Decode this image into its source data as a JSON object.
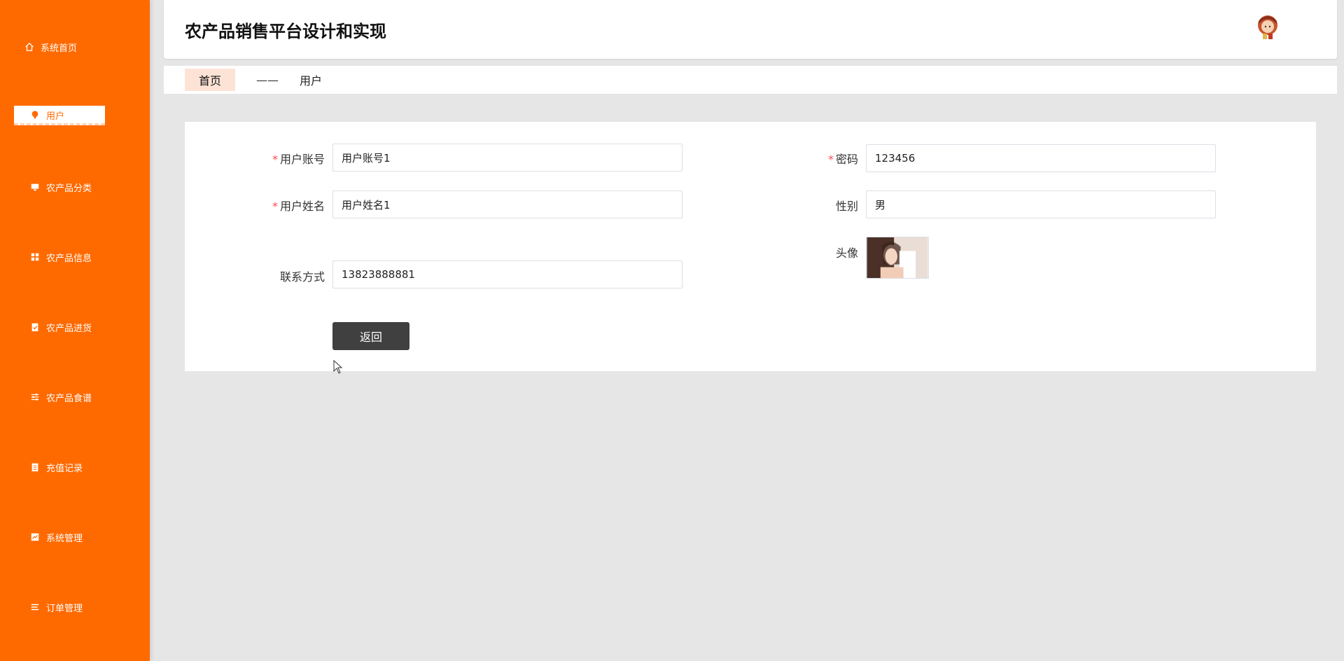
{
  "app": {
    "title": "农产品销售平台设计和实现"
  },
  "sidebar": {
    "items": [
      {
        "label": "系统首页",
        "icon": "home-icon"
      },
      {
        "label": "用户",
        "icon": "location-pin-icon",
        "active": true
      },
      {
        "label": "农产品分类",
        "icon": "monitor-icon"
      },
      {
        "label": "农产品信息",
        "icon": "grid-icon"
      },
      {
        "label": "农产品进货",
        "icon": "clipboard-check-icon"
      },
      {
        "label": "农产品食谱",
        "icon": "sliders-icon"
      },
      {
        "label": "充值记录",
        "icon": "clipboard-icon"
      },
      {
        "label": "系统管理",
        "icon": "chart-icon"
      },
      {
        "label": "订单管理",
        "icon": "list-icon"
      }
    ]
  },
  "breadcrumb": {
    "home": "首页",
    "separator": "——",
    "current": "用户"
  },
  "form": {
    "account_label": "用户账号",
    "account_value": "用户账号1",
    "password_label": "密码",
    "password_value": "123456",
    "name_label": "用户姓名",
    "name_value": "用户姓名1",
    "gender_label": "性别",
    "gender_value": "男",
    "avatar_label": "头像",
    "contact_label": "联系方式",
    "contact_value": "13823888881",
    "required_mark": "*",
    "back_label": "返回"
  },
  "colors": {
    "sidebar_bg": "#ff6a00",
    "page_bg": "#e6e6e6",
    "button_bg": "#404040",
    "required": "#ff4d4f"
  }
}
